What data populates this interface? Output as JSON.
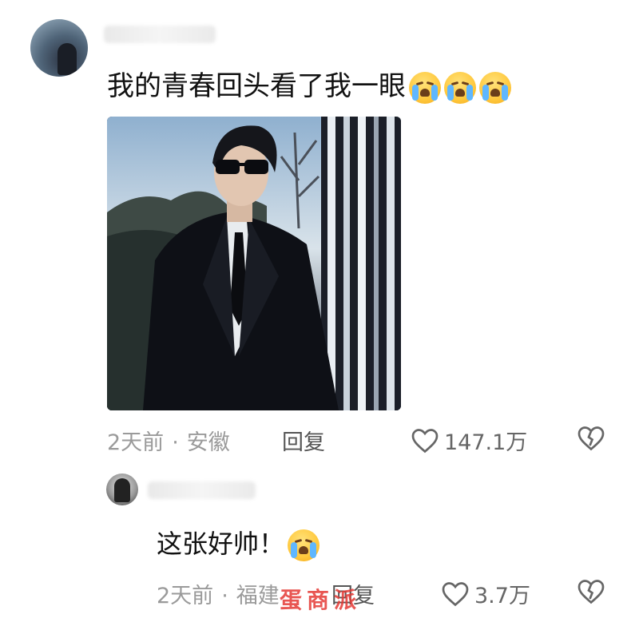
{
  "comment": {
    "text": "我的青春回头看了我一眼",
    "emoji_icons": [
      "loudly-crying-face-icon",
      "loudly-crying-face-icon",
      "loudly-crying-face-icon"
    ],
    "time": "2天前",
    "separator": "·",
    "location": "安徽",
    "reply_label": "回复",
    "likes": "147.1万"
  },
  "reply": {
    "text": "这张好帅！",
    "emoji_icons": [
      "loudly-crying-face-icon"
    ],
    "time": "2天前",
    "separator": "·",
    "location": "福建",
    "reply_label": "回复",
    "likes": "3.7万"
  },
  "icons": {
    "like": "heart-outline-icon",
    "dislike": "broken-heart-icon"
  },
  "watermark": "蛋商派",
  "colors": {
    "meta_text": "#9a9a9a",
    "icon_stroke": "#666666",
    "watermark": "#e53935"
  }
}
